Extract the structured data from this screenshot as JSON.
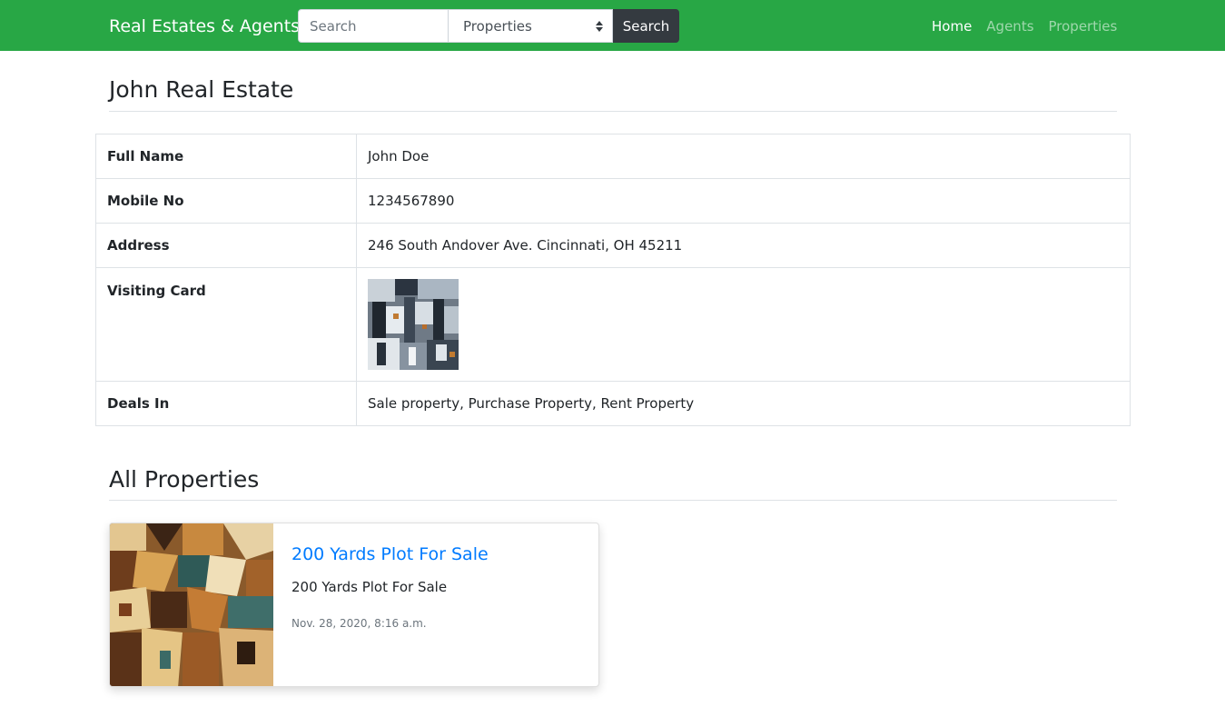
{
  "navbar": {
    "brand": "Real Estates & Agents",
    "search_placeholder": "Search",
    "search_category": "Properties",
    "search_button": "Search",
    "links": [
      "Home",
      "Agents",
      "Properties"
    ],
    "active_link": "Home",
    "bg_color": "#28a745"
  },
  "agent": {
    "title": "John Real Estate",
    "fields": [
      {
        "label": "Full Name",
        "value": "John Doe"
      },
      {
        "label": "Mobile No",
        "value": "1234567890"
      },
      {
        "label": "Address",
        "value": "246 South Andover Ave. Cincinnati, OH 45211"
      },
      {
        "label": "Visiting Card",
        "value": ""
      },
      {
        "label": "Deals In",
        "value": "Sale property, Purchase Property, Rent Property"
      }
    ]
  },
  "properties": {
    "title": "All Properties",
    "items": [
      {
        "title": "200 Yards Plot For Sale",
        "description": "200 Yards Plot For Sale",
        "date": "Nov. 28, 2020, 8:16 a.m."
      }
    ]
  },
  "colors": {
    "link": "#007bff",
    "dark_button": "#343a40"
  }
}
